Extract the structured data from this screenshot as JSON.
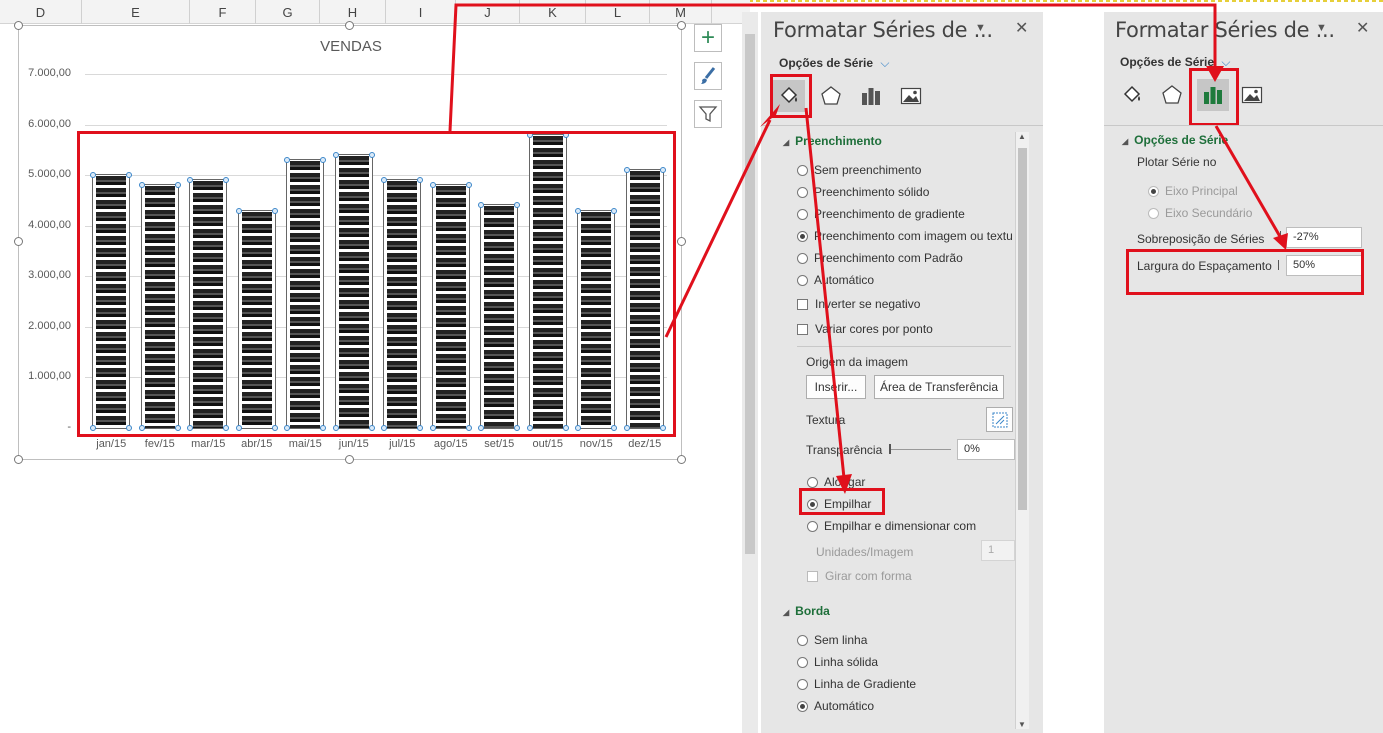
{
  "sheet": {
    "columns": [
      "D",
      "E",
      "F",
      "G",
      "H",
      "I",
      "J",
      "K",
      "L",
      "M"
    ]
  },
  "chart": {
    "title": "VENDAS",
    "y_ticks": [
      "7.000,00",
      "6.000,00",
      "5.000,00",
      "4.000,00",
      "3.000,00",
      "2.000,00",
      "1.000,00",
      "-"
    ],
    "buttons": [
      "plus-icon",
      "brush-icon",
      "filter-icon"
    ]
  },
  "chart_data": {
    "type": "bar",
    "title": "VENDAS",
    "categories": [
      "jan/15",
      "fev/15",
      "mar/15",
      "abr/15",
      "mai/15",
      "jun/15",
      "jul/15",
      "ago/15",
      "set/15",
      "out/15",
      "nov/15",
      "dez/15"
    ],
    "values": [
      5000,
      4800,
      4900,
      4300,
      5300,
      5400,
      4900,
      4800,
      4400,
      5800,
      4300,
      5100
    ],
    "ylim": [
      0,
      7000
    ],
    "grid": true,
    "legend": "none"
  },
  "panel1": {
    "title": "Formatar Séries de ...",
    "subtitle": "Opções de Série",
    "icons": [
      "paint-bucket-icon",
      "pentagon-icon",
      "bar-chart-icon",
      "image-icon"
    ],
    "section_fill": "Preenchimento",
    "fill_options": [
      {
        "label": "Sem preenchimento",
        "checked": false
      },
      {
        "label": "Preenchimento sólido",
        "checked": false
      },
      {
        "label": "Preenchimento de gradiente",
        "checked": false
      },
      {
        "label": "Preenchimento com imagem ou textu",
        "checked": true
      },
      {
        "label": "Preenchimento com Padrão",
        "checked": false
      },
      {
        "label": "Automático",
        "checked": false
      }
    ],
    "invert_label": "Inverter se negativo",
    "vary_label": "Variar cores por ponto",
    "image_source_label": "Origem da imagem",
    "insert_button": "Inserir...",
    "clipboard_button": "Área de Transferência",
    "texture_label": "Textura",
    "transparency_label": "Transparência",
    "transparency_value": "0%",
    "stretch_label": "Alongar",
    "stack_label": "Empilhar",
    "stack_scale_label": "Empilhar e dimensionar com",
    "units_label": "Unidades/Imagem",
    "units_value": "1",
    "rotate_label": "Girar com forma",
    "section_border": "Borda",
    "border_options": [
      {
        "label": "Sem linha",
        "checked": false
      },
      {
        "label": "Linha sólida",
        "checked": false
      },
      {
        "label": "Linha de Gradiente",
        "checked": false
      },
      {
        "label": "Automático",
        "checked": true
      }
    ]
  },
  "panel2": {
    "title": "Formatar Séries de ...",
    "subtitle": "Opções de Série",
    "section": "Opções de Série",
    "plot_label": "Plotar Série no",
    "primary_axis": "Eixo Principal",
    "secondary_axis": "Eixo Secundário",
    "overlap_label": "Sobreposição de Séries",
    "overlap_value": "-27%",
    "gap_label": "Largura do Espaçamento",
    "gap_value": "50%"
  },
  "colors": {
    "annotation_red": "#e0101c",
    "section_green": "#1e6f3a",
    "bar_fill": "#222222",
    "selection_blue": "#3b86c9"
  }
}
